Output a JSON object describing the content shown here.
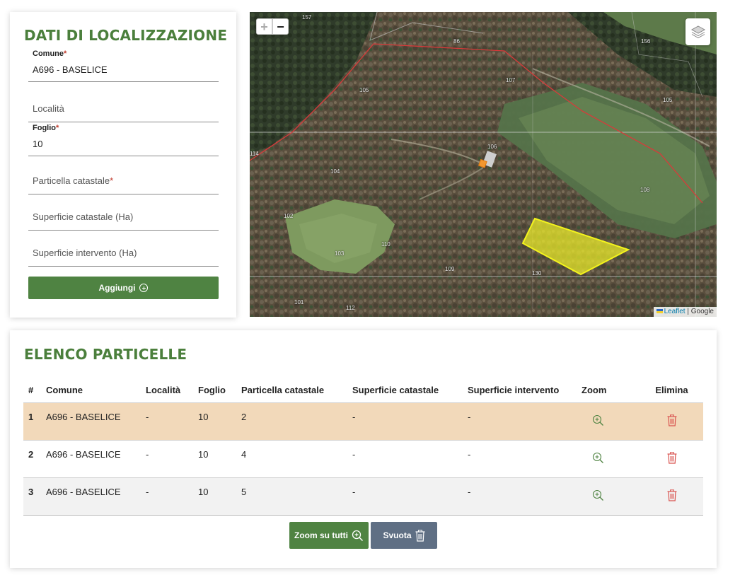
{
  "form": {
    "title": "DATI DI LOCALIZZAZIONE",
    "comune_label": "Comune",
    "comune_value": "A696 - BASELICE",
    "localita_placeholder": "Località",
    "foglio_label": "Foglio",
    "foglio_value": "10",
    "particella_placeholder": "Particella catastale",
    "superficie_catastale_placeholder": "Superficie catastale (Ha)",
    "superficie_intervento_placeholder": "Superficie intervento (Ha)",
    "required_mark": "*",
    "add_button": "Aggiungi"
  },
  "map": {
    "zoom_in": "+",
    "zoom_out": "−",
    "attribution_leaflet": "Leaflet",
    "attribution_sep": " | ",
    "attribution_google": "Google",
    "parcel_labels": [
      "157",
      "86",
      "156",
      "105",
      "107",
      "105",
      "106",
      "104",
      "108",
      "102",
      "110",
      "103",
      "109",
      "130",
      "101",
      "112",
      "114"
    ]
  },
  "list": {
    "title": "ELENCO PARTICELLE",
    "headers": [
      "#",
      "Comune",
      "Località",
      "Foglio",
      "Particella catastale",
      "Superficie catastale",
      "Superficie intervento",
      "Zoom",
      "Elimina"
    ],
    "rows": [
      {
        "n": "1",
        "comune": "A696 - BASELICE",
        "localita": "-",
        "foglio": "10",
        "particella": "2",
        "sup_cat": "-",
        "sup_int": "-"
      },
      {
        "n": "2",
        "comune": "A696 - BASELICE",
        "localita": "-",
        "foglio": "10",
        "particella": "4",
        "sup_cat": "-",
        "sup_int": "-"
      },
      {
        "n": "3",
        "comune": "A696 - BASELICE",
        "localita": "-",
        "foglio": "10",
        "particella": "5",
        "sup_cat": "-",
        "sup_int": "-"
      }
    ],
    "zoom_all_button": "Zoom su tutti",
    "empty_button": "Svuota"
  },
  "colors": {
    "accent_green": "#4f8342",
    "title_green": "#4b7f3c",
    "highlight_row": "#f2d9ba",
    "delete_red": "#d9534f",
    "svuota_gray": "#5f6f84",
    "parcel_yellow": "#e8e82a"
  }
}
